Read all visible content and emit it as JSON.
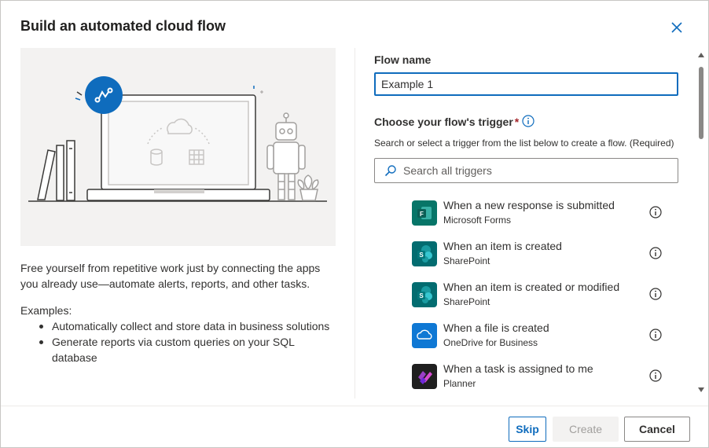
{
  "dialog": {
    "title": "Build an automated cloud flow"
  },
  "left": {
    "intro": "Free yourself from repetitive work just by connecting the apps you already use—automate alerts, reports, and other tasks.",
    "examples_label": "Examples:",
    "examples": [
      "Automatically collect and store data in business solutions",
      "Generate reports via custom queries on your SQL database"
    ]
  },
  "form": {
    "flow_name_label": "Flow name",
    "flow_name_value": "Example 1",
    "trigger_label": "Choose your flow's trigger",
    "required_mark": "*",
    "helper": "Search or select a trigger from the list below to create a flow. (Required)",
    "search_placeholder": "Search all triggers"
  },
  "triggers": [
    {
      "title": "When a new response is submitted",
      "app": "Microsoft Forms",
      "icon": "forms-icon",
      "color": "#077568"
    },
    {
      "title": "When an item is created",
      "app": "SharePoint",
      "icon": "sharepoint-icon",
      "color": "#036c70"
    },
    {
      "title": "When an item is created or modified",
      "app": "SharePoint",
      "icon": "sharepoint-icon",
      "color": "#036c70"
    },
    {
      "title": "When a file is created",
      "app": "OneDrive for Business",
      "icon": "onedrive-icon",
      "color": "#0364b8"
    },
    {
      "title": "When a task is assigned to me",
      "app": "Planner",
      "icon": "planner-icon",
      "color": "#7719aa"
    }
  ],
  "footer": {
    "skip": "Skip",
    "create": "Create",
    "cancel": "Cancel"
  },
  "colors": {
    "accent": "#0f6cbd",
    "required": "#a4262c",
    "illustration_bg": "#f3f2f1"
  }
}
